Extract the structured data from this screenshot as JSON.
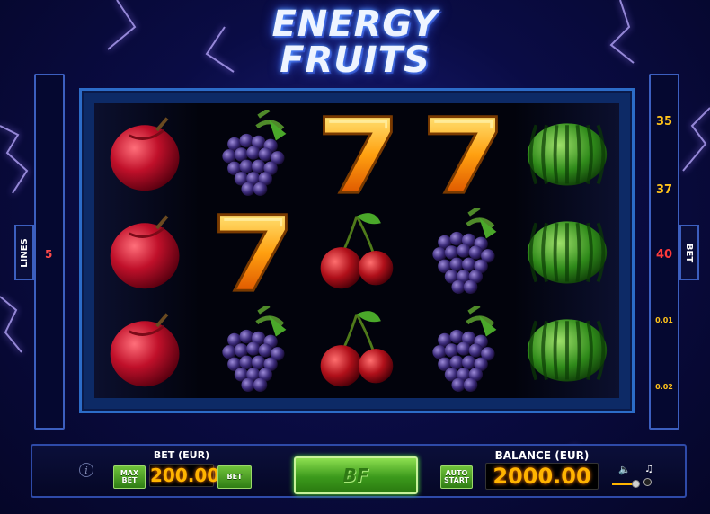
{
  "game": {
    "title_line1": "ENERGY",
    "title_line2": "FRUITS"
  },
  "side": {
    "lines_label": "LINES",
    "lines_value": "5",
    "bet_label": "BET",
    "line_numbers": [
      {
        "value": "35",
        "color": "#ffc21a"
      },
      {
        "value": "37",
        "color": "#ffc21a"
      },
      {
        "value": "40",
        "color": "#ff3a3a"
      },
      {
        "value": "0.01",
        "color": "#ffc21a"
      },
      {
        "value": "0.02",
        "color": "#ffc21a"
      }
    ]
  },
  "reels": [
    [
      "plum",
      "plum",
      "plum"
    ],
    [
      "grapes",
      "seven",
      "grapes"
    ],
    [
      "seven",
      "cherry",
      "cherry"
    ],
    [
      "seven",
      "grapes",
      "grapes"
    ],
    [
      "watermelon",
      "watermelon",
      "watermelon"
    ]
  ],
  "controls": {
    "info_icon": "info-icon",
    "max_bet_line1": "MAX",
    "max_bet_line2": "BET",
    "bet_label": "BET (EUR)",
    "bet_value": "200.00",
    "bet_button": "BET",
    "spin_logo": "BF",
    "auto_start_line1": "AUTO",
    "auto_start_line2": "START",
    "balance_label": "BALANCE (EUR)",
    "balance_value": "2000.00",
    "volume_icon": "speaker-icon",
    "music_icon": "music-note-icon",
    "volume_level": 1.0
  },
  "colors": {
    "accent_green": "#3c9a1c",
    "value_amber": "#ffb400",
    "frame_blue": "#2c6cc8"
  }
}
